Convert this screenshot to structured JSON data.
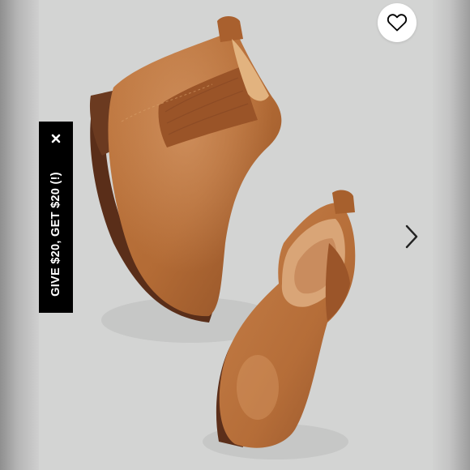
{
  "listing": {
    "image": {
      "product_type": "chelsea boots",
      "primary_color": "#b86f3a",
      "background_color": "#d3d4d3"
    },
    "like_button": {
      "icon": "heart-outline-icon"
    },
    "next_button": {
      "icon": "chevron-right-icon"
    }
  },
  "promo_banner": {
    "text": "GIVE $20, GET $20 (!)",
    "close_icon": "close-icon",
    "background": "#000000",
    "text_color": "#ffffff"
  }
}
